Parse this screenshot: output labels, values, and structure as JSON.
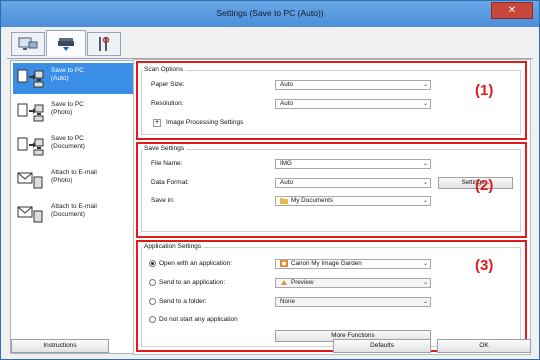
{
  "window": {
    "title": "Settings (Save to PC (Auto))",
    "close_label": "✕"
  },
  "tabs": [
    {
      "name": "scan-from-computer-tab",
      "icon": "computer-scan-icon"
    },
    {
      "name": "scan-from-panel-tab",
      "icon": "scanner-icon"
    },
    {
      "name": "general-settings-tab",
      "icon": "tools-icon"
    }
  ],
  "nav": {
    "items": [
      {
        "line1": "Save to PC",
        "line2": "(Auto)",
        "selected": true
      },
      {
        "line1": "Save to PC",
        "line2": "(Photo)",
        "selected": false
      },
      {
        "line1": "Save to PC",
        "line2": "(Document)",
        "selected": false
      },
      {
        "line1": "Attach to E-mail",
        "line2": "(Photo)",
        "selected": false
      },
      {
        "line1": "Attach to E-mail",
        "line2": "(Document)",
        "selected": false
      }
    ]
  },
  "scan_options": {
    "title": "Scan Options",
    "paper_size_label": "Paper Size:",
    "paper_size_value": "Auto",
    "resolution_label": "Resolution:",
    "resolution_value": "Auto",
    "image_processing_label": "Image Processing Settings",
    "expand_symbol": "+",
    "marker": "(1)"
  },
  "save_settings": {
    "title": "Save Settings",
    "file_name_label": "File Name:",
    "file_name_value": "IMG",
    "data_format_label": "Data Format:",
    "data_format_value": "Auto",
    "settings_button": "Settings...",
    "save_in_label": "Save in:",
    "save_in_value": "My Documents",
    "marker": "(2)"
  },
  "app_settings": {
    "title": "Application Settings",
    "open_with_label": "Open with an application:",
    "open_with_value": "Canon My Image Garden",
    "open_with_selected": true,
    "send_app_label": "Send to an application:",
    "send_app_value": "Preview",
    "send_folder_label": "Send to a folder:",
    "send_folder_value": "None",
    "no_app_label": "Do not start any application",
    "more_functions_button": "More Functions",
    "marker": "(3)"
  },
  "footer": {
    "instructions_button": "Instructions",
    "defaults_button": "Defaults",
    "ok_button": "OK"
  },
  "dropdown_arrow": "⌄",
  "colors": {
    "accent_red": "#e01b1b",
    "selection_blue": "#3a8ee6",
    "title_bar": "#5a9ae0"
  }
}
